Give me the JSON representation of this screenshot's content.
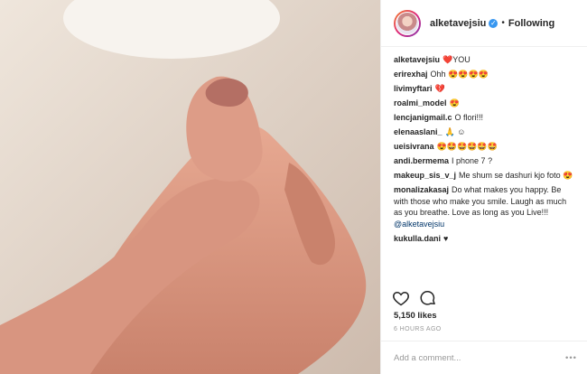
{
  "header": {
    "username": "alketavejsiu",
    "follow_status": "Following",
    "separator": "•"
  },
  "comments": [
    {
      "user": "alketavejsiu",
      "text": "❤️YOU"
    },
    {
      "user": "erirexhaj",
      "text": "Ohh 😍😍😍😍"
    },
    {
      "user": "livimyftari",
      "text": "💔"
    },
    {
      "user": "roalmi_model",
      "text": "😍"
    },
    {
      "user": "lencjanigmail.c",
      "text": "O flori!!!"
    },
    {
      "user": "elenaaslani_",
      "text": "🙏 ☺"
    },
    {
      "user": "ueisivrana",
      "text": "😍🤩🤩🤩🤩🤩"
    },
    {
      "user": "andi.bermema",
      "text": "I phone 7 ?"
    },
    {
      "user": "makeup_sis_v_j",
      "text": "Me shum se dashuri kjo foto 😍"
    },
    {
      "user": "monalizakasaj",
      "text": "Do what makes you happy. Be with those who make you smile. Laugh as much as you breathe. Love as long as you Live!!! @alketavejsiu"
    },
    {
      "user": "kukulla.dani",
      "text": "♥"
    }
  ],
  "likes": "5,150 likes",
  "time": "6 HOURS AGO",
  "add_comment_placeholder": "Add a comment...",
  "more_label": "•••",
  "icons": [
    "heart-icon",
    "comment-icon",
    "verified-icon"
  ],
  "colors": {
    "verified": "#3897f0",
    "link": "#003569"
  }
}
